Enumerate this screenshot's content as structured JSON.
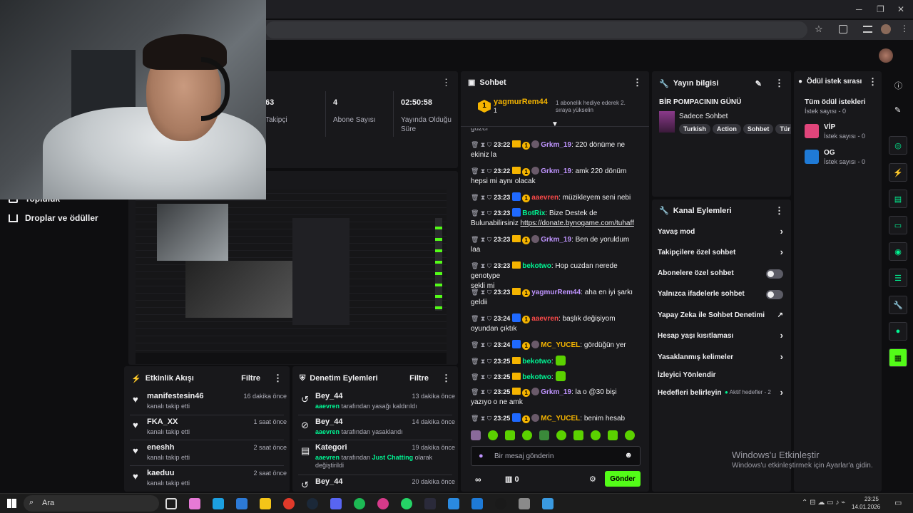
{
  "browser": {
    "min": "─",
    "restore": "❐",
    "close": "✕",
    "star": "☆"
  },
  "left_nav": {
    "items": [
      {
        "label": "Topluluk"
      },
      {
        "label": "Droplar ve ödüller"
      }
    ]
  },
  "stats": [
    {
      "value": "63",
      "label": "Takipçi"
    },
    {
      "value": "4",
      "label": "Abone Sayısı"
    },
    {
      "value": "02:50:58",
      "label": "Yayında Olduğu Süre"
    }
  ],
  "event_feed": {
    "title": "Etkinlik Akışı",
    "filter": "Filtre",
    "items": [
      {
        "name": "manifestesin46",
        "time": "16 dakika önce",
        "sub": "kanalı takip etti"
      },
      {
        "name": "FKA_XX",
        "time": "1 saat önce",
        "sub": "kanalı takip etti"
      },
      {
        "name": "eneshh",
        "time": "2 saat önce",
        "sub": "kanalı takip etti"
      },
      {
        "name": "kaeduu",
        "time": "2 saat önce",
        "sub": "kanalı takip etti"
      }
    ]
  },
  "mod_actions": {
    "title": "Denetim Eylemleri",
    "filter": "Filtre",
    "items": [
      {
        "name": "Bey_44",
        "time": "13 dakika önce",
        "actor": "aaevren",
        "rest": " tarafından yasağı kaldırıldı"
      },
      {
        "name": "Bey_44",
        "time": "14 dakika önce",
        "actor": "aaevren",
        "rest": " tarafından yasaklandı"
      },
      {
        "name": "Kategori",
        "time": "19 dakika önce",
        "actor": "aaevren",
        "mid": " tarafından ",
        "highlight": "Just Chatting",
        "rest2": " olarak",
        "line3": "değiştirildi"
      },
      {
        "name": "Bey_44",
        "time": "20 dakika önce"
      }
    ]
  },
  "chat": {
    "title": "Sohbet",
    "pinned": {
      "user": "yagmurRem44",
      "count": "1",
      "text": "1 abonelik hediye ederek 2. sıraya yükselin"
    },
    "top_cut": "güzel",
    "messages": [
      {
        "time": "23:22",
        "user": "Grkm_19",
        "ucolor": "#bf94ff",
        "text": ": 220 dönüme ne",
        "line2": "ekiniz la"
      },
      {
        "time": "23:22",
        "user": "Grkm_19",
        "ucolor": "#bf94ff",
        "text": ": amk 220 dönüm",
        "line2": "hepsi mi aynı olacak"
      },
      {
        "time": "23:23",
        "user": "aaevren",
        "ucolor": "#ff4a4a",
        "text": ": müzikleyem seni nebi",
        "line2": ""
      },
      {
        "time": "23:23",
        "user": "BotRix",
        "ucolor": "#00f593",
        "text": ": Bize Destek de",
        "line2": "Bulunabilirsiniz ",
        "link": "https://donate.bynogame.com/tuhaff"
      },
      {
        "time": "23:23",
        "user": "Grkm_19",
        "ucolor": "#bf94ff",
        "text": ": Ben de yoruldum",
        "line2": "laa"
      },
      {
        "time": "23:23",
        "user": "bekotwo",
        "ucolor": "#00f593",
        "text": ": Hop cuzdan nerede genotype",
        "line2": "sekli mi"
      },
      {
        "time": "23:23",
        "user": "yagmurRem44",
        "ucolor": "#bf94ff",
        "text": ": aha en iyi şarkı",
        "line2": "geldii"
      },
      {
        "time": "23:24",
        "user": "aaevren",
        "ucolor": "#ff4a4a",
        "text": ": başlık değişiyom",
        "line2": "oyundan çıktık"
      },
      {
        "time": "23:24",
        "user": "MC_YUCEL",
        "ucolor": "#f5b400",
        "text": ": gördüğün yer",
        "line2": ""
      },
      {
        "time": "23:25",
        "user": "bekotwo",
        "ucolor": "#00f593",
        "text": ":",
        "line2": ""
      },
      {
        "time": "23:25",
        "user": "bekotwo",
        "ucolor": "#00f593",
        "text": ":",
        "line2": ""
      },
      {
        "time": "23:25",
        "user": "Grkm_19",
        "ucolor": "#bf94ff",
        "text": ": la o @30 bişi",
        "line2": "yazıyo o ne amk"
      },
      {
        "time": "23:25",
        "user": "MC_YUCEL",
        "ucolor": "#f5b400",
        "text": ": benim hesab",
        "line2": ""
      }
    ],
    "input_placeholder": "Bir mesaj gönderin",
    "infinity": "∞",
    "gift_count": "0",
    "send": "Gönder"
  },
  "stream_info": {
    "title": "Yayın bilgisi",
    "stream_title": "BİR POMPACININ GÜNÜ",
    "category": "Sadece Sohbet",
    "tags": [
      "Turkish",
      "Action",
      "Sohbet",
      "Tür"
    ]
  },
  "rewards": {
    "title": "Ödül istek sırası",
    "all": "Tüm ödül istekleri",
    "all_count": "İstek sayısı - 0",
    "items": [
      {
        "name": "VİP",
        "count": "İstek sayısı - 0",
        "color": "#e0457b"
      },
      {
        "name": "OG",
        "count": "İstek sayısı - 0",
        "color": "#1f7ad6"
      }
    ]
  },
  "channel_actions": {
    "title": "Kanal Eylemleri",
    "items": [
      {
        "label": "Yavaş mod",
        "control": "chevron"
      },
      {
        "label": "Takipçilere özel sohbet",
        "control": "chevron"
      },
      {
        "label": "Abonelere özel sohbet",
        "control": "toggle"
      },
      {
        "label": "Yalnızca ifadelerle sohbet",
        "control": "toggle"
      },
      {
        "label": "Yapay Zeka ile Sohbet Denetimi",
        "control": "external"
      },
      {
        "label": "Hesap yaşı kısıtlaması",
        "control": "chevron"
      },
      {
        "label": "Yasaklanmış kelimeler",
        "control": "chevron"
      },
      {
        "label": "İzleyici Yönlendir",
        "control": "none"
      },
      {
        "label": "Hedefleri belirleyin",
        "control": "chevron",
        "status": "Aktif hedefler - 2"
      }
    ]
  },
  "watermark": {
    "line1": "Windows'u Etkinleştir",
    "line2": "Windows'u etkinleştirmek için Ayarlar'a gidin."
  },
  "taskbar": {
    "search": "Ara",
    "time": "23:25",
    "date": "14.01.2026"
  },
  "colors": {
    "accent": "#53fc18",
    "bg": "#0e0e10",
    "panel": "#18181b"
  }
}
